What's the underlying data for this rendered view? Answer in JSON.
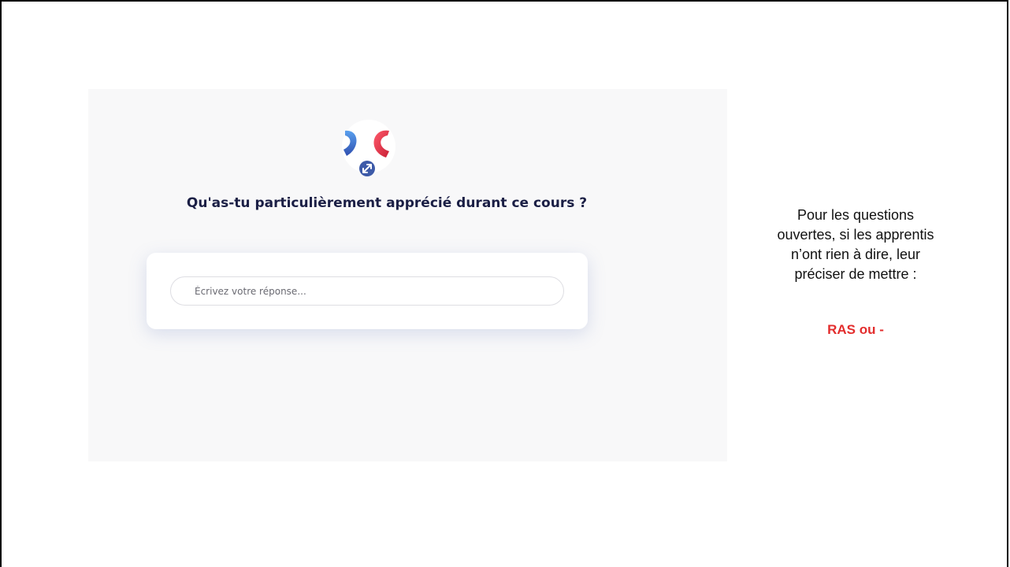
{
  "question": {
    "title": "Qu'as-tu particulièrement apprécié durant ce cours ?"
  },
  "answer": {
    "placeholder": "Écrivez votre réponse...",
    "value": ""
  },
  "logo": {
    "icon": "brand-logo-dc",
    "badge_icon": "expand-arrows-icon",
    "colors": {
      "blue": "#3a72d8",
      "red": "#e8283c",
      "badge": "#3d5aa8"
    }
  },
  "note": {
    "lines": [
      "Pour les questions",
      "ouvertes, si les apprentis",
      "n’ont rien à dire, leur",
      "préciser de mettre :"
    ],
    "emphasis": "RAS ou -",
    "emphasis_color": "#e32d2d"
  }
}
